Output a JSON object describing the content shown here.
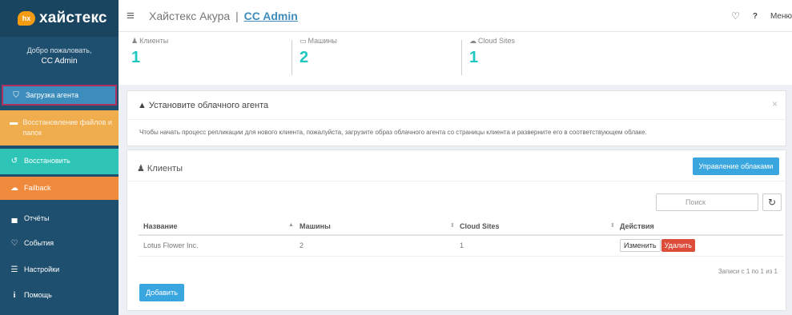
{
  "brand": {
    "badge": "hx",
    "name": "хайстекс",
    "badge_color": "#f39c12"
  },
  "sidebar": {
    "welcome": "Добро пожаловать,",
    "user": "CC Admin",
    "items": [
      {
        "label": "Загрузка агента",
        "icon": "shield-icon",
        "color": "#3c8dbc"
      },
      {
        "label": "Восстановление файлов и папок",
        "icon": "folder-icon",
        "color": "#f0ad4e"
      },
      {
        "label": "Восстановить",
        "icon": "restore-icon",
        "color": "#2ec4b6"
      },
      {
        "label": "Failback",
        "icon": "cloud-upload-icon",
        "color": "#ef8a3c"
      },
      {
        "label": "Отчёты",
        "icon": "bar-chart-icon"
      },
      {
        "label": "События",
        "icon": "bell-icon"
      },
      {
        "label": "Настройки",
        "icon": "sliders-icon"
      },
      {
        "label": "Помощь",
        "icon": "info-icon"
      }
    ]
  },
  "header": {
    "title_main": "Хайстекс Акура",
    "title_sep": "|",
    "title_admin": "CC Admin",
    "help": "?",
    "menu": "Меню"
  },
  "stats": [
    {
      "label": "Клиенты",
      "value": "1",
      "icon": "users-icon"
    },
    {
      "label": "Машины",
      "value": "2",
      "icon": "monitor-icon"
    },
    {
      "label": "Cloud Sites",
      "value": "1",
      "icon": "cloud-icon"
    }
  ],
  "alert": {
    "title": "Установите облачного агента",
    "message": "Чтобы начать процесс репликации для нового клиента, пожалуйста, загрузите образ облачного агента со страницы клиента и разверните его в соответствующем облаке.",
    "close": "×"
  },
  "clients": {
    "title": "Клиенты",
    "manage_clouds": "Управление облаками",
    "search_placeholder": "Поиск",
    "columns": [
      "Название",
      "Машины",
      "Cloud Sites",
      "Действия"
    ],
    "rows": [
      {
        "name": "Lotus Flower Inc.",
        "machines": "2",
        "cloud_sites": "1",
        "edit": "Изменить",
        "delete": "Удалить"
      }
    ],
    "records": "Записи с 1 по 1 из 1",
    "add": "Добавить"
  }
}
